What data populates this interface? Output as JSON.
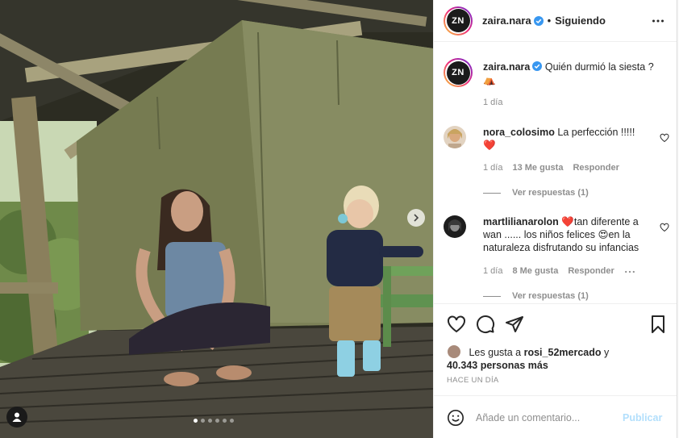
{
  "post": {
    "author": "zaira.nara",
    "avatar_initials": "ZN",
    "follow_status": "Siguiendo",
    "caption": "Quién durmió la siesta ?",
    "caption_emoji": "⛺",
    "caption_age": "1 día"
  },
  "comments": [
    {
      "user": "nora_colosimo",
      "text": "La perfección !!!!!",
      "emoji": "❤️",
      "age": "1 día",
      "likes": "13 Me gusta",
      "reply_label": "Responder",
      "view_replies": "Ver respuestas (1)"
    },
    {
      "user": "martlilianarolon",
      "text_before": "",
      "emoji1": "❤️",
      "text_mid": "tan diferente a wan ...... los niños felices",
      "emoji2": "😍",
      "text_after": "en la naturaleza disfrutando su infancias",
      "age": "1 día",
      "likes": "8 Me gusta",
      "reply_label": "Responder",
      "view_replies": "Ver respuestas (1)"
    }
  ],
  "likes_summary": {
    "prefix": "Les gusta a",
    "first_user": "rosi_52mercado",
    "connector": "y",
    "others": "40.343 personas más"
  },
  "time_ago": "HACE UN DÍA",
  "comment_box": {
    "placeholder": "Añade un comentario...",
    "publish_label": "Publicar"
  },
  "carousel": {
    "total": 6,
    "active": 1
  },
  "colors": {
    "accent_blue": "#0095f6",
    "verified": "#3897f0",
    "publish_disabled": "#b2dffc",
    "text_muted": "#8e8e8e"
  },
  "icons": [
    "verified-icon",
    "more-icon",
    "heart-icon",
    "comment-icon",
    "share-icon",
    "bookmark-icon",
    "emoji-icon",
    "next-arrow-icon",
    "user-tag-icon"
  ]
}
